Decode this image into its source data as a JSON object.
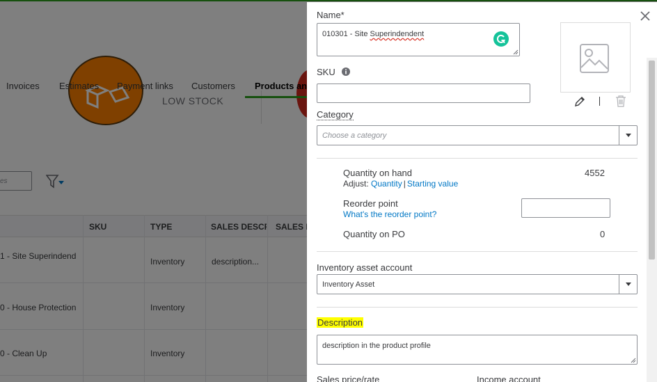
{
  "background": {
    "tabs": [
      {
        "label": "Invoices"
      },
      {
        "label": "Estimates"
      },
      {
        "label": "Payment links"
      },
      {
        "label": "Customers"
      },
      {
        "label": "Products and"
      }
    ],
    "low_stock_label": "LOW STOCK",
    "search_placeholder": "ces",
    "table": {
      "headers": [
        "SKU",
        "TYPE",
        "SALES DESCRI",
        "SALES P"
      ],
      "rows": [
        {
          "name": "1 - Site Superindend",
          "type": "Inventory",
          "description": "description..."
        },
        {
          "name": "0 - House Protection",
          "type": "Inventory",
          "description": ""
        },
        {
          "name": "0 - Clean Up",
          "type": "Inventory",
          "description": ""
        }
      ]
    }
  },
  "panel": {
    "name_label": "Name*",
    "name_value_prefix": "010301 - Site ",
    "name_value_misspelled": "Superindendent",
    "sku_label": "SKU",
    "category_label": "Category",
    "category_placeholder": "Choose a category",
    "quantity_on_hand_label": "Quantity on hand",
    "quantity_on_hand_value": "4552",
    "adjust_label": "Adjust:",
    "adjust_quantity_link": "Quantity",
    "adjust_separator": "|",
    "adjust_starting_value_link": "Starting value",
    "reorder_point_label": "Reorder point",
    "reorder_point_help_link": "What's the reorder point?",
    "quantity_on_po_label": "Quantity on PO",
    "quantity_on_po_value": "0",
    "inventory_asset_account_label": "Inventory asset account",
    "inventory_asset_account_value": "Inventory Asset",
    "description_label": "Description",
    "description_value": "description in the product profile",
    "sales_price_label": "Sales price/rate",
    "income_account_label": "Income account"
  },
  "colors": {
    "accent_green": "#2ca01c",
    "link_blue": "#0077c5",
    "highlight_yellow": "#ffff00",
    "grammarly_green": "#15c39a"
  }
}
